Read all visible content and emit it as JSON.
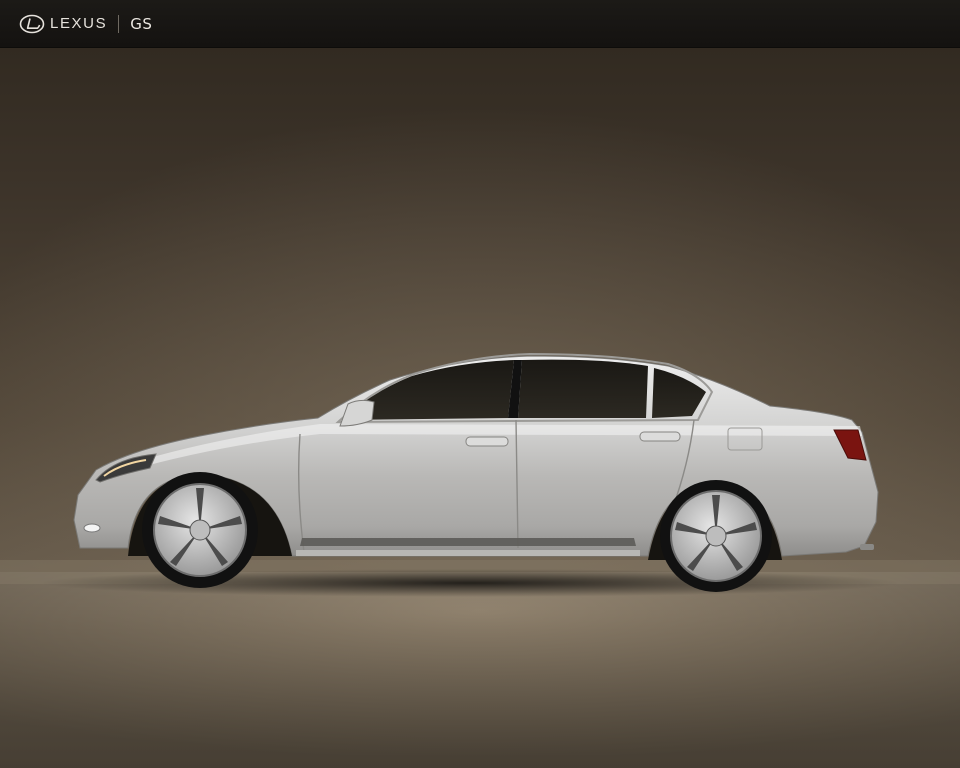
{
  "header": {
    "brand": "LEXUS",
    "model": "GS",
    "logo_icon": "lexus-emblem-icon"
  },
  "photo": {
    "subject_icon": "silver-sedan-side-view-photo",
    "colors": {
      "backdrop_top": "#2e271e",
      "backdrop_mid": "#5b5042",
      "floor": "#8c7e6b",
      "car_body": "#c9c9c9",
      "header_bar": "#1a1815"
    }
  }
}
